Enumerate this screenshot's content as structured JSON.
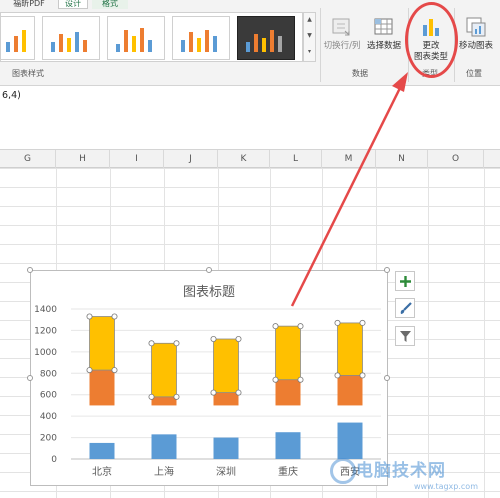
{
  "ribbon": {
    "tabs": [
      "福昕PDF",
      "设计",
      "格式"
    ],
    "groups": {
      "chart_styles": "图表样式",
      "data": "数据",
      "type": "类型",
      "location": "位置"
    },
    "buttons": {
      "switch_row_col": "切换行/列",
      "select_data": "选择数据",
      "change_chart_type_line1": "更改",
      "change_chart_type_line2": "图表类型",
      "move_chart": "移动图表"
    }
  },
  "formula_bar": {
    "text": "6,4)"
  },
  "columns": [
    "G",
    "H",
    "I",
    "J",
    "K",
    "L",
    "M",
    "N",
    "O"
  ],
  "chart_data": {
    "type": "bar",
    "title": "图表标题",
    "categories": [
      "北京",
      "上海",
      "深圳",
      "重庆",
      "西安"
    ],
    "ylim": [
      0,
      1400
    ],
    "yticks": [
      "0",
      "200",
      "400",
      "600",
      "800",
      "1000",
      "1200",
      "1400"
    ],
    "series": [
      {
        "values": [
          150,
          230,
          200,
          250,
          340
        ],
        "color": "#5b9bd5"
      },
      {
        "values": [
          830,
          580,
          620,
          740,
          780
        ],
        "color": "#ed7d31",
        "base": 500
      },
      {
        "values": [
          1330,
          1080,
          1120,
          1240,
          1270
        ],
        "color": "#ffc000"
      }
    ],
    "grid": true,
    "legend": "none"
  },
  "watermark": {
    "text": "电脑技术网",
    "url": "www.tagxp.com"
  }
}
